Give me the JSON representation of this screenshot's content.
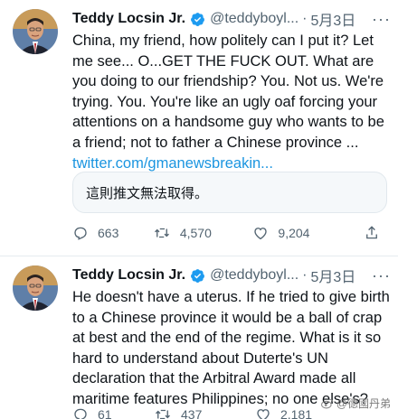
{
  "tweets": [
    {
      "author": {
        "name": "Teddy Locsin Jr.",
        "handle": "@teddyboyl...",
        "time": "5月3日"
      },
      "text": "China, my friend, how politely can I put it? Let me see... O...GET THE FUCK OUT. What are you doing to our friendship? You. Not us. We're trying. You. You're like an ugly oaf forcing your attentions on a handsome guy who wants to be a friend; not to father a Chinese province ...",
      "link": "twitter.com/gmanewsbreakin...",
      "quote_unavailable": "這則推文無法取得。",
      "stats": {
        "replies": "663",
        "retweets": "4,570",
        "likes": "9,204"
      }
    },
    {
      "author": {
        "name": "Teddy Locsin Jr.",
        "handle": "@teddyboyl...",
        "time": "5月3日"
      },
      "text": "He doesn't have a uterus. If he tried to give birth to a Chinese province it would be a ball of crap at best and the end of the regime. What is it so hard to understand about Duterte's UN declaration that the Arbitral Award made all maritime features Philippines; no one else's?",
      "stats": {
        "replies": "61",
        "retweets": "437",
        "likes": "2,181"
      }
    }
  ],
  "watermark": "@德國丹弟",
  "colors": {
    "link": "#1b95e0",
    "verified": "#1d9bf0",
    "muted": "#536471"
  }
}
